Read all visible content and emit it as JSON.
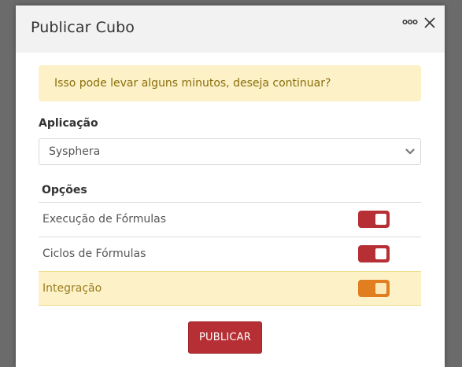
{
  "dialog": {
    "title": "Publicar Cubo"
  },
  "alert": {
    "message": "Isso pode levar alguns minutos, deseja continuar?"
  },
  "application": {
    "label": "Aplicação",
    "selected": "Sysphera"
  },
  "options": {
    "label": "Opções",
    "items": [
      {
        "label": "Execução de Fórmulas",
        "enabled": true
      },
      {
        "label": "Ciclos de Fórmulas",
        "enabled": true
      },
      {
        "label": "Integração",
        "enabled": true
      }
    ]
  },
  "actions": {
    "publish_label": "PUBLICAR"
  },
  "icons": {
    "more": "more-options-icon",
    "close": "close-icon",
    "chevron": "chevron-down-icon"
  },
  "colors": {
    "toggle_on": "#b52f34",
    "toggle_highlight": "#e07e20",
    "alert_bg": "#fcf1c7",
    "primary_button": "#b52f34"
  }
}
